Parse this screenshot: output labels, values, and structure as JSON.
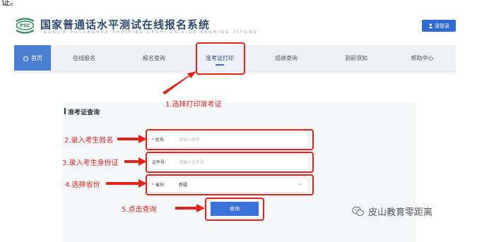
{
  "top_fragment": "证。",
  "header": {
    "logo_text": "PSC",
    "title": "国家普通话水平测试在线报名系统",
    "subtitle": "GUOJIA PUTONGHUA SHUIPING CESHI ZAIXIAN BAOMING XITONG",
    "login_label": "请登录"
  },
  "nav": {
    "home": "首页",
    "items": [
      "在线报名",
      "报名查询",
      "准考证打印",
      "成绩查询",
      "测前须知",
      "帮助中心"
    ],
    "active": "准考证打印"
  },
  "form": {
    "section_title": "准考证查询",
    "name_label": "姓名:",
    "name_placeholder": "请输入姓名",
    "id_label": "证件号:",
    "id_placeholder": "请输入证件号",
    "province_label": "省份:",
    "province_value": "新疆",
    "query_label": "查询"
  },
  "annotations": {
    "step1": "1.选择打印准考证",
    "step2": "2.录入考生姓名",
    "step3": "3.录入考生身份证",
    "step4": "4.选择省份",
    "step5": "5.点击查询"
  },
  "watermark": "皮山教育零距离",
  "colors": {
    "accent": "#3b72d9",
    "annotation": "#e3231a",
    "nav_bg": "#eef2f8"
  }
}
